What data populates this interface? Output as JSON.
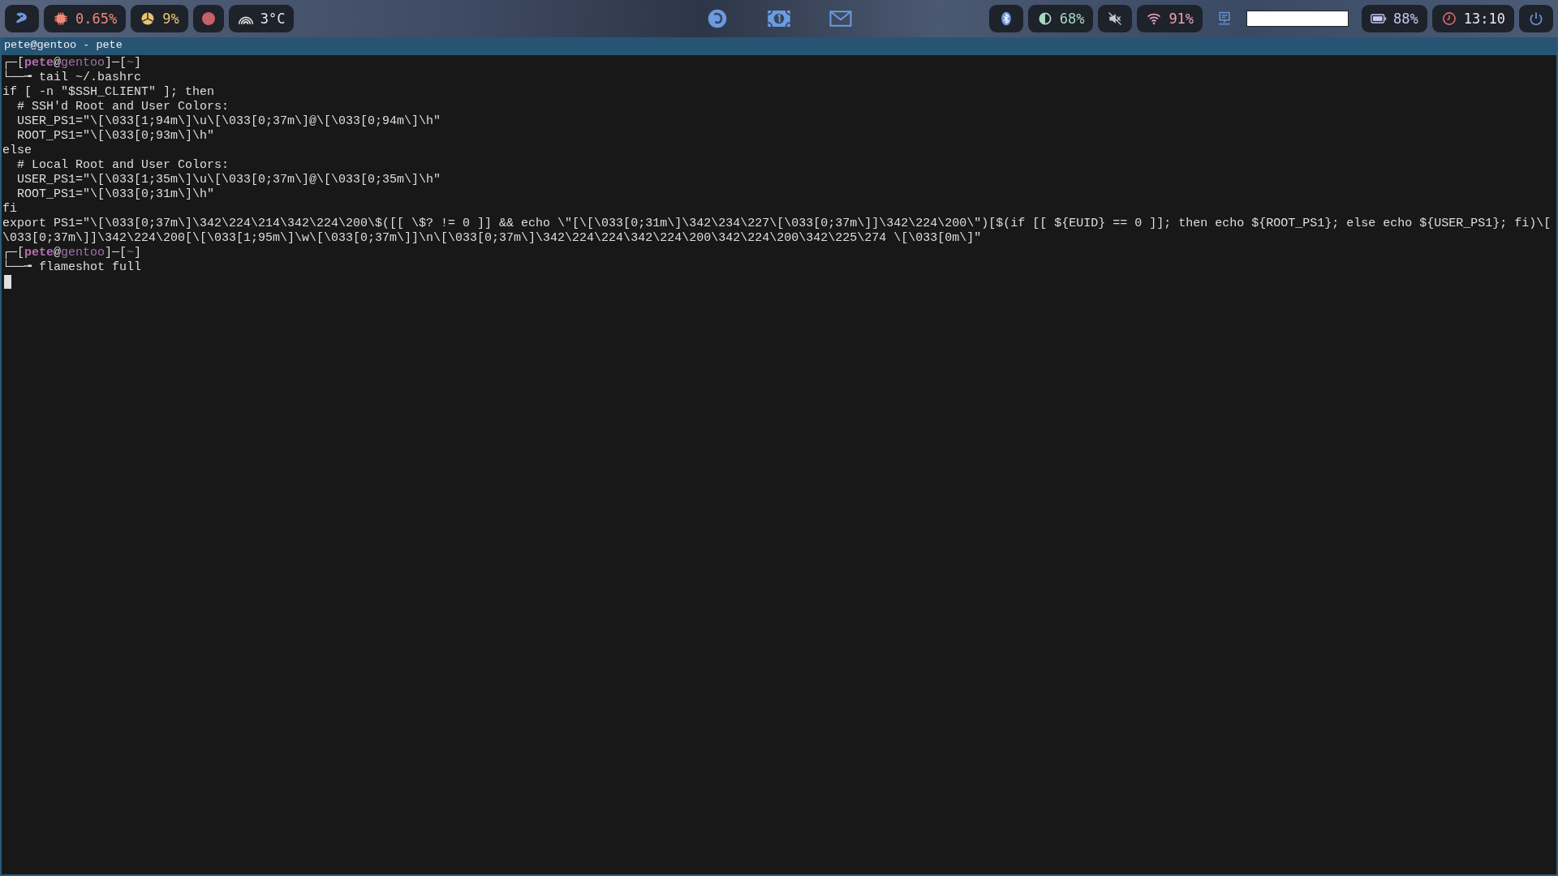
{
  "top_bar": {
    "left": [
      {
        "kind": "logo"
      },
      {
        "kind": "cpu",
        "text": "0.65%",
        "color": "#f08878"
      },
      {
        "kind": "memory",
        "text": "9%",
        "color": "#e8c46c"
      },
      {
        "kind": "record",
        "color": "#c8606a"
      },
      {
        "kind": "temperature",
        "text": "3°C",
        "color": "#e6e6e6"
      }
    ],
    "center": [
      {
        "kind": "browser"
      },
      {
        "kind": "money"
      },
      {
        "kind": "mail"
      }
    ],
    "right": [
      {
        "kind": "bluetooth"
      },
      {
        "kind": "brightness",
        "text": "68%",
        "color": "#a6d8c4"
      },
      {
        "kind": "muted"
      },
      {
        "kind": "wifi",
        "text": "91%",
        "color": "#e8a0b4"
      },
      {
        "kind": "network"
      },
      {
        "kind": "field"
      },
      {
        "kind": "battery",
        "text": "88%",
        "color": "#c4c8f4"
      },
      {
        "kind": "clock",
        "text": "13:10",
        "color": "#e6e6e6"
      },
      {
        "kind": "power"
      }
    ]
  },
  "terminal": {
    "title": "pete@gentoo - pete",
    "lines": [
      {
        "kind": "prompt",
        "segments": [
          {
            "kind": "frame",
            "text": "┌─["
          },
          {
            "kind": "user",
            "text": "pete"
          },
          {
            "kind": "frame",
            "text": "@"
          },
          {
            "kind": "host",
            "text": "gentoo"
          },
          {
            "kind": "frame",
            "text": "]─["
          },
          {
            "kind": "host",
            "text": "~"
          },
          {
            "kind": "frame",
            "text": "]"
          }
        ]
      },
      {
        "kind": "prompt",
        "segments": [
          {
            "kind": "frame",
            "text": "└──╼ tail ~/.bashrc"
          }
        ]
      },
      {
        "kind": "text",
        "text": "if [ -n \"$SSH_CLIENT\" ]; then"
      },
      {
        "kind": "text",
        "text": "  # SSH'd Root and User Colors:"
      },
      {
        "kind": "text",
        "text": "  USER_PS1=\"\\[\\033[1;94m\\]\\u\\[\\033[0;37m\\]@\\[\\033[0;94m\\]\\h\""
      },
      {
        "kind": "text",
        "text": "  ROOT_PS1=\"\\[\\033[0;93m\\]\\h\""
      },
      {
        "kind": "text",
        "text": "else"
      },
      {
        "kind": "text",
        "text": "  # Local Root and User Colors:"
      },
      {
        "kind": "text",
        "text": "  USER_PS1=\"\\[\\033[1;35m\\]\\u\\[\\033[0;37m\\]@\\[\\033[0;35m\\]\\h\""
      },
      {
        "kind": "text",
        "text": "  ROOT_PS1=\"\\[\\033[0;31m\\]\\h\""
      },
      {
        "kind": "text",
        "text": "fi"
      },
      {
        "kind": "text",
        "text": "export PS1=\"\\[\\033[0;37m\\]\\342\\224\\214\\342\\224\\200\\$([[ \\$? != 0 ]] && echo \\\"[\\[\\033[0;31m\\]\\342\\234\\227\\[\\033[0;37m\\]]\\342\\224\\200\\\")[$(if [[ ${EUID} == 0 ]]; then echo ${ROOT_PS1}; else echo ${USER_PS1}; fi)\\["
      },
      {
        "kind": "text",
        "text": "\\033[0;37m\\]]\\342\\224\\200[\\[\\033[1;95m\\]\\w\\[\\033[0;37m\\]]\\n\\[\\033[0;37m\\]\\342\\224\\224\\342\\224\\200\\342\\224\\200\\342\\225\\274 \\[\\033[0m\\]\""
      },
      {
        "kind": "prompt",
        "segments": [
          {
            "kind": "frame",
            "text": "┌─["
          },
          {
            "kind": "user",
            "text": "pete"
          },
          {
            "kind": "frame",
            "text": "@"
          },
          {
            "kind": "host",
            "text": "gentoo"
          },
          {
            "kind": "frame",
            "text": "]─["
          },
          {
            "kind": "host",
            "text": "~"
          },
          {
            "kind": "frame",
            "text": "]"
          }
        ]
      },
      {
        "kind": "prompt",
        "segments": [
          {
            "kind": "frame",
            "text": "└──╼ flameshot full"
          }
        ]
      },
      {
        "kind": "cursor"
      }
    ]
  }
}
